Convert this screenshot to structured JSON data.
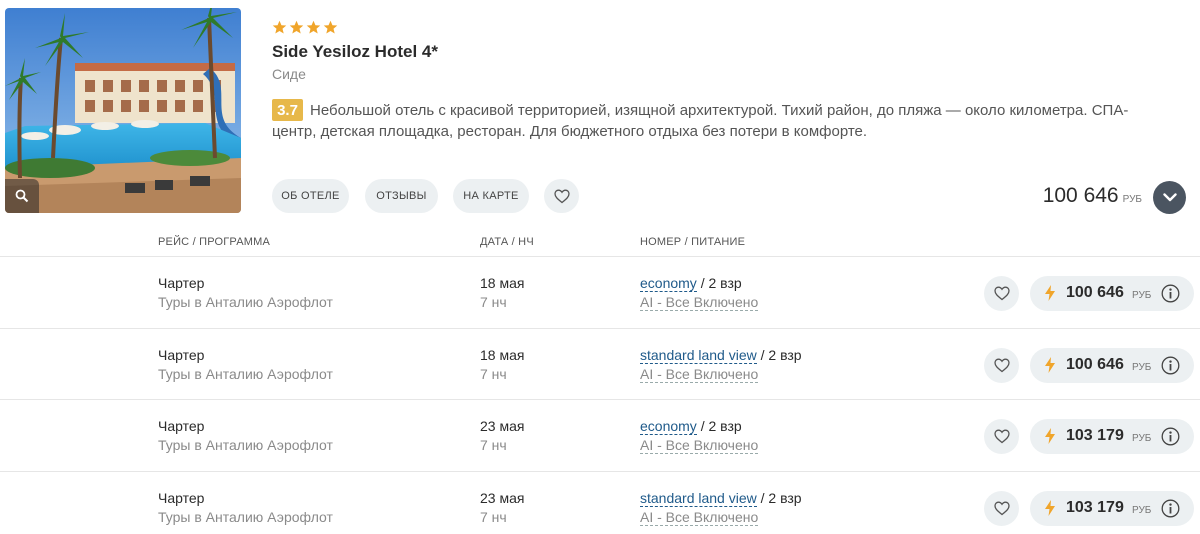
{
  "hotel": {
    "stars": 4,
    "name": "Side Yesiloz Hotel 4*",
    "city": "Сиде",
    "rating": "3.7",
    "description": "Небольшой отель с красивой территорией, изящной архитектурой. Тихий район, до пляжа — около километра. СПА-центр, детская площадка, ресторан. Для бюджетного отдыха без потери в комфорте.",
    "buttons": {
      "about": "ОБ ОТЕЛЕ",
      "reviews": "ОТЗЫВЫ",
      "map": "НА КАРТЕ"
    },
    "price": "100 646",
    "currency": "РУБ"
  },
  "table": {
    "headers": {
      "route": "РЕЙС / ПРОГРАММА",
      "date": "ДАТА / НЧ",
      "room": "НОМЕР / ПИТАНИЕ"
    },
    "rows": [
      {
        "flight": "Чартер",
        "program": "Туры в Анталию Аэрофлот",
        "date": "18 мая",
        "nights": "7 нч",
        "room": "economy",
        "guests": " / 2 взр",
        "meal": "AI - Все Включено",
        "price": "100 646",
        "currency": "РУБ"
      },
      {
        "flight": "Чартер",
        "program": "Туры в Анталию Аэрофлот",
        "date": "18 мая",
        "nights": "7 нч",
        "room": "standard land view",
        "guests": " / 2 взр",
        "meal": "AI - Все Включено",
        "price": "100 646",
        "currency": "РУБ"
      },
      {
        "flight": "Чартер",
        "program": "Туры в Анталию Аэрофлот",
        "date": "23 мая",
        "nights": "7 нч",
        "room": "economy",
        "guests": " / 2 взр",
        "meal": "AI - Все Включено",
        "price": "103 179",
        "currency": "РУБ"
      },
      {
        "flight": "Чартер",
        "program": "Туры в Анталию Аэрофлот",
        "date": "23 мая",
        "nights": "7 нч",
        "room": "standard land view",
        "guests": " / 2 взр",
        "meal": "AI - Все Включено",
        "price": "103 179",
        "currency": "РУБ"
      }
    ]
  },
  "colors": {
    "star": "#f0a52b",
    "rating_badge": "#e7b84a",
    "link": "#1f5a8a",
    "bolt": "#f0a52b",
    "expand_button": "#4b5561"
  },
  "icons": {
    "zoom": "magnifier-icon",
    "favorite": "heart-icon",
    "expand": "chevron-down-icon",
    "bolt": "lightning-icon",
    "info": "info-icon"
  }
}
